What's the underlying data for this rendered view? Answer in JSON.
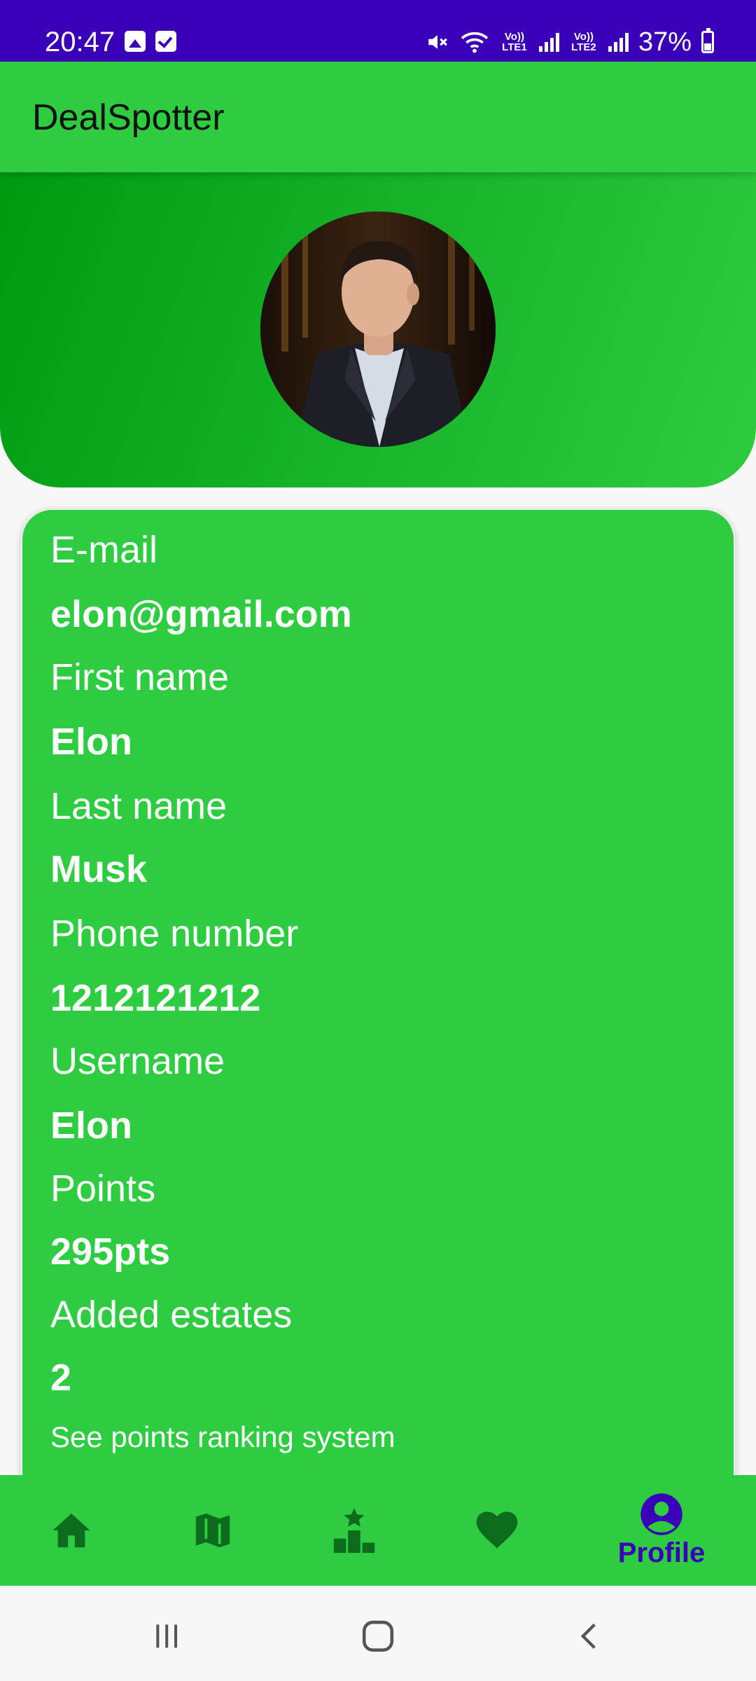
{
  "status_bar": {
    "time": "20:47",
    "left_icons": [
      "gallery-icon",
      "checkbox-icon"
    ],
    "right_icons": [
      "mute-icon",
      "wifi-icon",
      "signal-sim1-icon",
      "signal-sim2-icon",
      "battery-icon"
    ],
    "lte1": "Vo)) LTE1",
    "lte2": "Vo)) LTE2",
    "battery": "37%",
    "battery_level": 0.37
  },
  "app_bar": {
    "title": "DealSpotter"
  },
  "profile": {
    "avatar_alt": "",
    "fields": [
      {
        "label": "E-mail",
        "value": "elon@gmail.com"
      },
      {
        "label": "First name",
        "value": "Elon"
      },
      {
        "label": "Last name",
        "value": "Musk"
      },
      {
        "label": "Phone number",
        "value": "1212121212"
      },
      {
        "label": "Username",
        "value": "Elon"
      },
      {
        "label": "Points",
        "value": "295pts"
      },
      {
        "label": "Added estates",
        "value": "2"
      }
    ],
    "ranking_link": "See points ranking system"
  },
  "bottom_nav": {
    "items": [
      {
        "icon": "home-icon",
        "label": ""
      },
      {
        "icon": "map-icon",
        "label": ""
      },
      {
        "icon": "leaderboard-icon",
        "label": ""
      },
      {
        "icon": "heart-icon",
        "label": ""
      },
      {
        "icon": "account-circle-icon",
        "label": "Profile",
        "selected": true
      }
    ]
  },
  "colors": {
    "status_bar": "#3a00b8",
    "primary": "#2ecc40",
    "nav_icon": "#0d6b1d",
    "selected": "#3a00b8"
  }
}
